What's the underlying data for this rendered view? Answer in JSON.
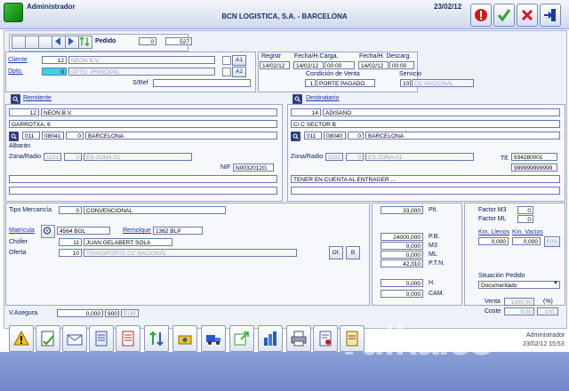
{
  "window": {
    "app_title": "Administrador",
    "company": "BCN LOGISTICA, S.A. - BARCELONA",
    "date": "23/02/12"
  },
  "toolbar_top": {
    "icons": [
      "alert-icon",
      "accept-icon",
      "cancel-icon",
      "exit-icon"
    ]
  },
  "record": {
    "label": "Pedido",
    "prefix": "0",
    "number": "527"
  },
  "cliente": {
    "label": "Cliente",
    "code": "12",
    "name": "NEON B.V.",
    "a1_label": "A1"
  },
  "dpto": {
    "label": "Dpto.",
    "code": "0",
    "name": "DPTO. PRINCIPAL",
    "a2_label": "A2"
  },
  "sref": {
    "label": "S/Ref"
  },
  "header_dates": {
    "registro_label": "Registr",
    "registro": "14/02/12",
    "carga_label": "Fecha/H.Carga.",
    "carga_date": "14/02/12",
    "carga_time": "00:00",
    "descarga_label": "Fecha/H. Descarg.",
    "descarga_date": "14/02/12",
    "descarga_time": "00:00",
    "condicion_label": "Condición de Venta",
    "condicion_code": "1",
    "condicion": "PORTE PAGADO",
    "servicio_label": "Servicio",
    "servicio_code": "10",
    "servicio": "CC NACIONAL"
  },
  "remitente": {
    "title": "Remitente",
    "code": "12",
    "name": "NEON B.V.",
    "address": "GARROTXA, 6",
    "country": "011",
    "zip": "08041",
    "pob": "0",
    "city": "BARCELONA",
    "albaran_label": "Albarán",
    "zona_label": "Zona/Radio",
    "zona_code": "1101",
    "zona_n": "0",
    "zona": "ES-ZONA-01",
    "nif_label": "NIF",
    "nif": "N0032012G"
  },
  "destinatario": {
    "title": "Destinatario",
    "code": "14",
    "name": "ADISANO",
    "address": "C/ C SECTOR B",
    "country": "011",
    "zip": "08040",
    "pob": "0",
    "city": "BARCELONA",
    "zona_label": "Zona/Radio",
    "zona_code": "1101",
    "zona_n": "0",
    "zona": "ES-ZONA-01",
    "tlf_label": "Tlf.",
    "tlf": "934280001",
    "tlf2": "999999999999",
    "note": "TENER EN CUENTA AL ENTRAGER ..."
  },
  "mercancia": {
    "label": "Tipo Mercancía",
    "code": "0",
    "value": "CONVENCIONAL"
  },
  "vehiculo": {
    "matricula_label": "Matrícula",
    "matricula": "4564 BGL",
    "remolque_label": "Remolque",
    "remolque": "1362 BLP",
    "chofer_label": "Chófer",
    "chofer_code": "11",
    "chofer": "JUAN GELABERT SOLA",
    "oferta_label": "Oferta",
    "oferta_code": "10",
    "oferta": "TRANSPORTE CC NACIONAL",
    "of_btn": "Of.",
    "b_btn": "B"
  },
  "medidas": {
    "plt": "33,000",
    "plt_label": "Plt.",
    "pb": "24000,000",
    "pb_label": "P.B.",
    "m3": "0,000",
    "m3_label": "M3",
    "ml": "0,000",
    "ml_label": "ML",
    "ptn": "42,310",
    "ptn_label": "P.T.N.",
    "h": "0,000",
    "h_label": "H.",
    "cam": "0,000",
    "cam_label": "CAM."
  },
  "factores": {
    "m3_label": "Factor M3",
    "m3": "0",
    "ml_label": "Factor ML",
    "ml": "0",
    "llenos_label": "Km. Llenos",
    "llenos": "0,000",
    "vacios_label": "Km. Vacios",
    "vacios": "0,000",
    "km_btn": "Kms"
  },
  "situacion": {
    "label": "Situación Pedido",
    "value": "Documentado",
    "venta_label": "Venta",
    "venta": "1300,00",
    "pct_label": "(%)",
    "coste_label": "Coste",
    "coste": "0,00",
    "coste_pct": "100,"
  },
  "asegura": {
    "label": "V.Asegura.",
    "value": "0,000",
    "code": "900",
    "currency": "EUR"
  },
  "status": {
    "user": "Administrador",
    "datetime": "23/02/12 15:53"
  },
  "watermark": "vulka.es",
  "colors": {
    "accent": "#1b2e66",
    "cyan": "#37d3e8",
    "footer": "#7f95d0"
  }
}
